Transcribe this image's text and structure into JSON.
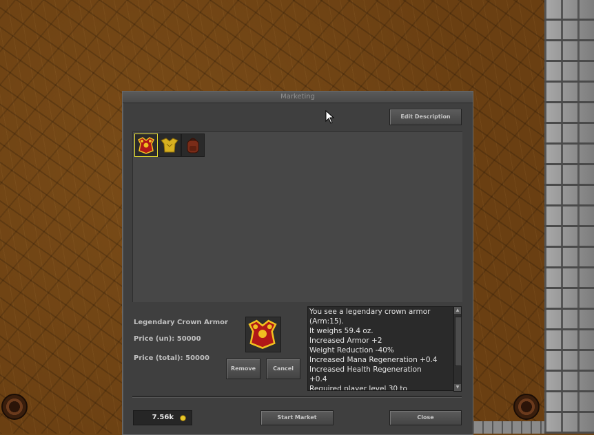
{
  "window": {
    "title": "Marketing",
    "edit_description_label": "Edit Description",
    "items": [
      {
        "icon": "legendary-crown-armor-icon",
        "selected": true
      },
      {
        "icon": "golden-armor-icon",
        "selected": false
      },
      {
        "icon": "backpack-icon",
        "selected": false
      }
    ],
    "selected_item": {
      "name": "Legendary Crown Armor",
      "price_un": "Price (un): 50000",
      "price_total": "Price (total): 50000"
    },
    "remove_label": "Remove",
    "cancel_label": "Cancel",
    "description_lines": [
      "You see a legendary crown armor",
      "(Arm:15).",
      "It weighs 59.4 oz.",
      "Increased Armor +2",
      "Weight Reduction -40%",
      "Increased Mana Regeneration +0.4",
      "Increased Health Regeneration",
      "+0.4",
      "Required player level 30 to"
    ],
    "balance": "7.56k",
    "start_market_label": "Start Market",
    "close_label": "Close"
  },
  "colors": {
    "window_bg": "#3f3f3f",
    "selection": "#e8e030",
    "coin": "#e8c828"
  }
}
